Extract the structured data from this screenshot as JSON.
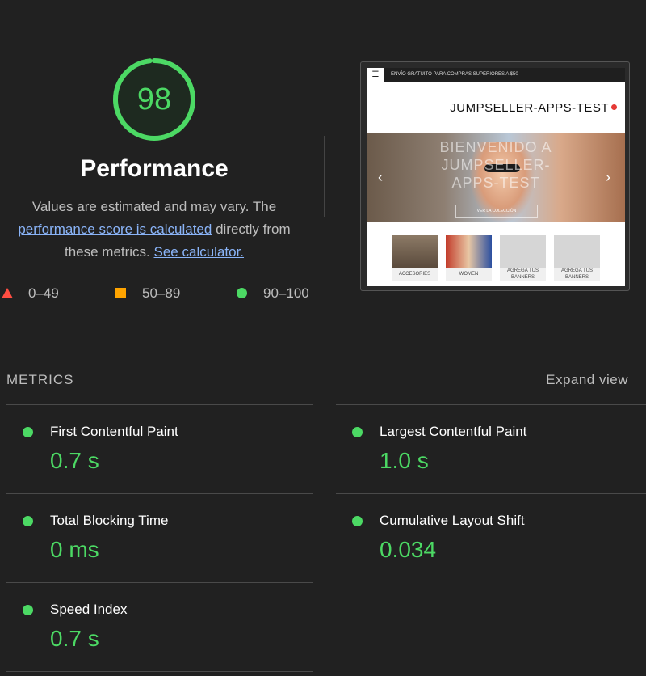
{
  "score": {
    "value": "98",
    "fraction": 0.98,
    "color": "#4cd964"
  },
  "performance": {
    "title": "Performance",
    "desc_prefix": "Values are estimated and may vary. The",
    "link_score": "performance score is calculated",
    "desc_middle": "directly from these metrics.",
    "link_calculator": "See calculator."
  },
  "legend": [
    {
      "range": "0–49",
      "shape": "triangle",
      "color": "#ff4e42"
    },
    {
      "range": "50–89",
      "shape": "square",
      "color": "#ffa400"
    },
    {
      "range": "90–100",
      "shape": "circle",
      "color": "#4cd964"
    }
  ],
  "thumbnail": {
    "promo": "ENVÍO GRATUITO PARA COMPRAS SUPERIORES A $50",
    "brand": "JUMPSELLER-APPS-TEST",
    "hero_text": "BIENVENIDO A JUMPSELLER-APPS-TEST",
    "hero_button": "VER LA COLECCIÓN",
    "categories": [
      "ACCESORIES",
      "WOMEN",
      "AGREGA TUS BANNERS",
      "AGREGA TUS BANNERS"
    ]
  },
  "metrics_section": {
    "title": "METRICS",
    "expand_label": "Expand view",
    "items": [
      {
        "label": "First Contentful Paint",
        "value": "0.7 s"
      },
      {
        "label": "Largest Contentful Paint",
        "value": "1.0 s"
      },
      {
        "label": "Total Blocking Time",
        "value": "0 ms"
      },
      {
        "label": "Cumulative Layout Shift",
        "value": "0.034"
      },
      {
        "label": "Speed Index",
        "value": "0.7 s"
      }
    ]
  }
}
